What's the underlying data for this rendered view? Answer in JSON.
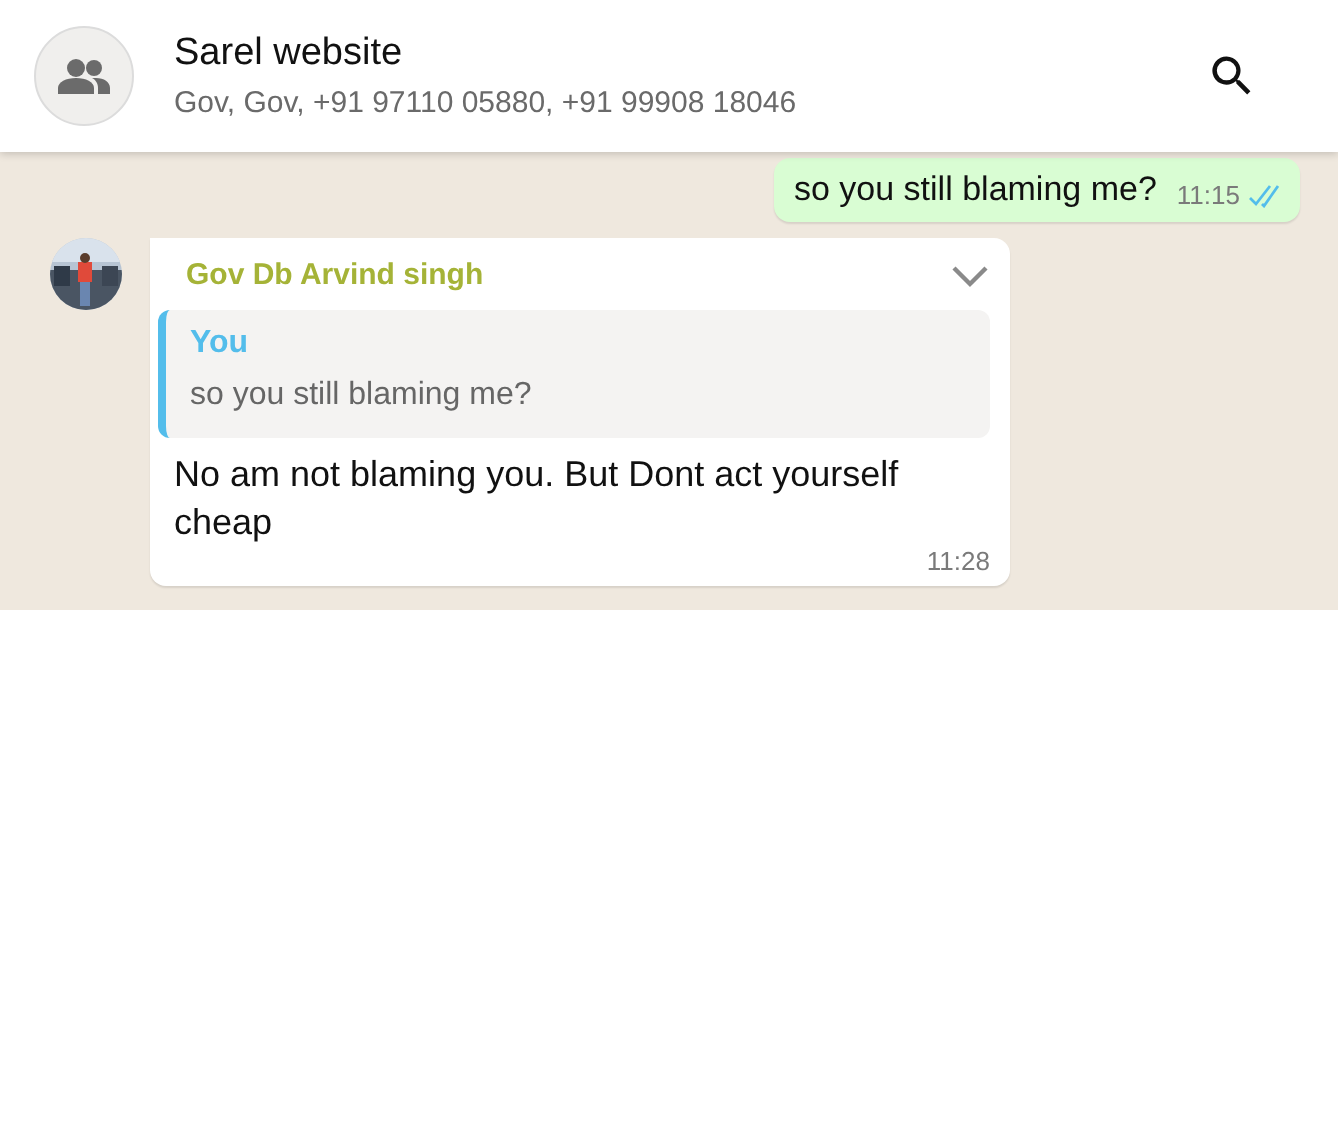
{
  "header": {
    "title": "Sarel website",
    "subtitle": "Gov, Gov, +91 97110 05880, +91 99908 18046"
  },
  "messages": [
    {
      "kind": "outgoing",
      "text": "so you still blaming me?",
      "time": "11:15",
      "read": true
    },
    {
      "kind": "incoming",
      "sender": "Gov Db Arvind singh",
      "quote": {
        "author": "You",
        "text": "so you still blaming me?"
      },
      "text": "No am not blaming you. But Dont act yourself cheap",
      "time": "11:28"
    }
  ]
}
